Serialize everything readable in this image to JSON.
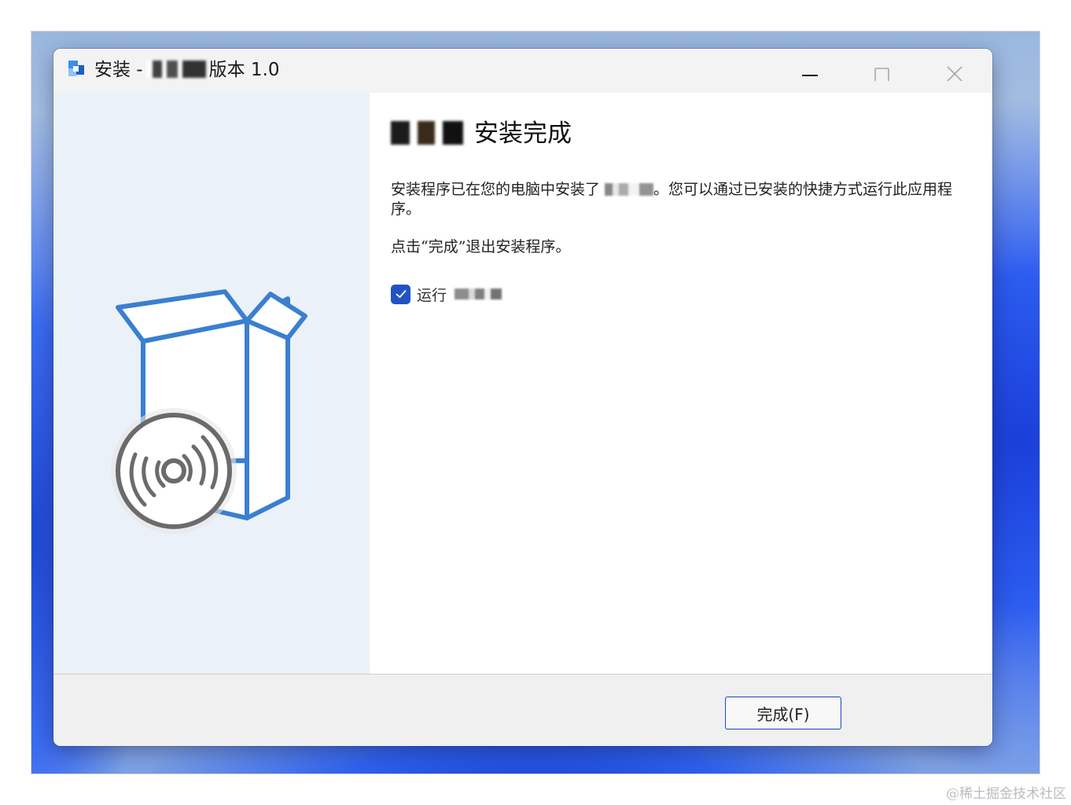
{
  "window": {
    "title_prefix": "安装 -",
    "title_suffix": "版本 1.0",
    "icons": {
      "app": "installer-app-icon",
      "minimize": "minimize-icon",
      "maximize": "maximize-icon",
      "close": "close-icon"
    }
  },
  "content": {
    "heading": "安装完成",
    "paragraph1_before": "安装程序已在您的电脑中安装了 ",
    "paragraph1_after": "。您可以通过已安装的快捷方式运行此应用程序。",
    "paragraph2": "点击“完成”退出安装程序。",
    "run_checkbox": {
      "label": "运行",
      "checked": true
    }
  },
  "footer": {
    "finish_button": "完成(F)"
  },
  "watermark": "@稀土掘金技术社区",
  "colors": {
    "accent": "#2154c2",
    "left_panel": "#eaf1f9",
    "illustration_blue": "#3a7fd0",
    "disc_gray": "#6b6b6b"
  }
}
